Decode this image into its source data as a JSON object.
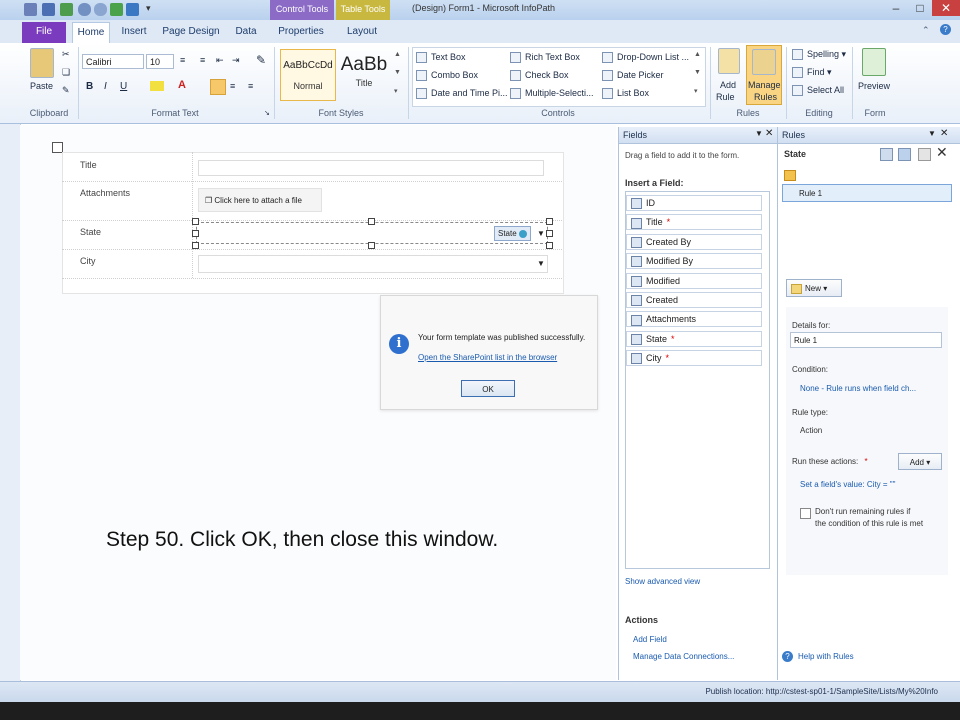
{
  "window": {
    "title": "(Design) Form1 - Microsoft InfoPath",
    "context_tabs": [
      "Control Tools",
      "Table Tools"
    ]
  },
  "tabs": [
    "File",
    "Home",
    "Insert",
    "Page Design",
    "Data",
    "Properties",
    "Layout"
  ],
  "ribbon": {
    "clipboard": {
      "paste": "Paste",
      "group": "Clipboard"
    },
    "font": {
      "name": "Calibri",
      "size": "10",
      "group": "Format Text"
    },
    "styles": {
      "normal_sample": "AaBbCcDd",
      "normal": "Normal",
      "title_sample": "AaBb",
      "title": "Title",
      "group": "Font Styles"
    },
    "controls": {
      "items": [
        "Text Box",
        "Rich Text Box",
        "Drop-Down List ...",
        "Combo Box",
        "Check Box",
        "Date Picker",
        "Date and Time Pi...",
        "Multiple-Selecti...",
        "List Box"
      ],
      "group": "Controls"
    },
    "rules": {
      "add_rule": "Add",
      "add_rule2": "Rule",
      "manage": "Manage",
      "manage2": "Rules",
      "group": "Rules"
    },
    "editing": {
      "spelling": "Spelling",
      "find": "Find",
      "select_all": "Select All",
      "group": "Editing"
    },
    "form": {
      "preview": "Preview",
      "group": "Form"
    }
  },
  "form": {
    "rows": [
      {
        "label": "Title"
      },
      {
        "label": "Attachments",
        "attach_text": "Click here to attach a file"
      },
      {
        "label": "State",
        "tag": "State"
      },
      {
        "label": "City"
      }
    ]
  },
  "dialog": {
    "message": "Your form template was published successfully.",
    "link": "Open the SharePoint list in the browser",
    "ok": "OK"
  },
  "caption": "Step 50. Click OK, then close this window.",
  "fields_pane": {
    "title": "Fields",
    "hint": "Drag a field to add it to the form.",
    "insert_label": "Insert a Field:",
    "items": [
      {
        "name": "ID",
        "req": ""
      },
      {
        "name": "Title",
        "req": "*"
      },
      {
        "name": "Created By",
        "req": ""
      },
      {
        "name": "Modified By",
        "req": ""
      },
      {
        "name": "Modified",
        "req": ""
      },
      {
        "name": "Created",
        "req": ""
      },
      {
        "name": "Attachments",
        "req": ""
      },
      {
        "name": "State",
        "req": "*"
      },
      {
        "name": "City",
        "req": "*"
      }
    ],
    "show_advanced": "Show advanced view",
    "actions_title": "Actions",
    "add_field": "Add Field",
    "manage_connections": "Manage Data Connections..."
  },
  "rules_pane": {
    "title": "Rules",
    "target": "State",
    "rule_item": "Rule 1",
    "new_button": "New",
    "details_label": "Details for:",
    "details_value": "Rule 1",
    "condition_label": "Condition:",
    "condition_value": "None - Rule runs when field ch...",
    "rule_type_label": "Rule type:",
    "rule_type_value": "Action",
    "run_actions_label": "Run these actions:",
    "run_actions_req": "*",
    "add_button": "Add",
    "action_value": "Set a field's value: City = \"\"",
    "dont_run_line1": "Don't run remaining rules if",
    "dont_run_line2": "the condition of this rule is met",
    "help": "Help with Rules"
  },
  "status": {
    "publish_location": "Publish location: http://cstest-sp01-1/SampleSite/Lists/My%20Info"
  },
  "colors": {
    "file_tab": "#7a3bbf",
    "control_tools": "#8b6bc6",
    "table_tools": "#c8b840",
    "manage_rules_highlight": "#f9d483"
  }
}
